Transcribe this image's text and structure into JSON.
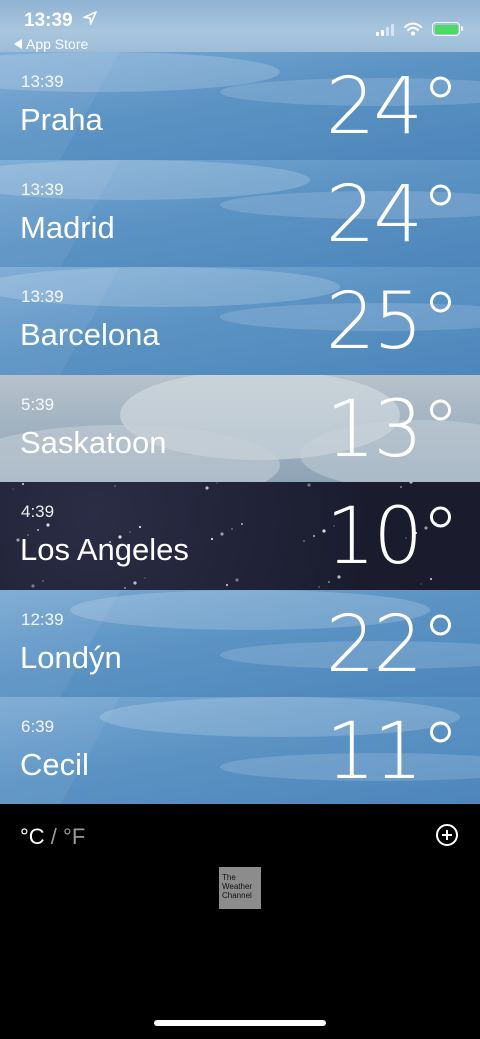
{
  "status": {
    "time": "13:39",
    "back_label": "App Store"
  },
  "cities": [
    {
      "time": "13:39",
      "name": "Praha",
      "temp": "24°",
      "theme": "clear-day"
    },
    {
      "time": "13:39",
      "name": "Madrid",
      "temp": "24°",
      "theme": "clear-day"
    },
    {
      "time": "13:39",
      "name": "Barcelona",
      "temp": "25°",
      "theme": "clear-day"
    },
    {
      "time": "5:39",
      "name": "Saskatoon",
      "temp": "13°",
      "theme": "cloudy"
    },
    {
      "time": "4:39",
      "name": "Los Angeles",
      "temp": "10°",
      "theme": "night"
    },
    {
      "time": "12:39",
      "name": "Londýn",
      "temp": "22°",
      "theme": "clear-day"
    },
    {
      "time": "6:39",
      "name": "Cecil",
      "temp": "11°",
      "theme": "clear-day"
    }
  ],
  "footer": {
    "unit_c": "°C",
    "unit_sep": " / ",
    "unit_f": "°F",
    "provider_logo": "The Weather Channel"
  },
  "colors": {
    "clear_day": "#5b93c4",
    "cloudy": "#a9b8c6",
    "night": "#1c1f33",
    "battery": "#4cd964"
  }
}
